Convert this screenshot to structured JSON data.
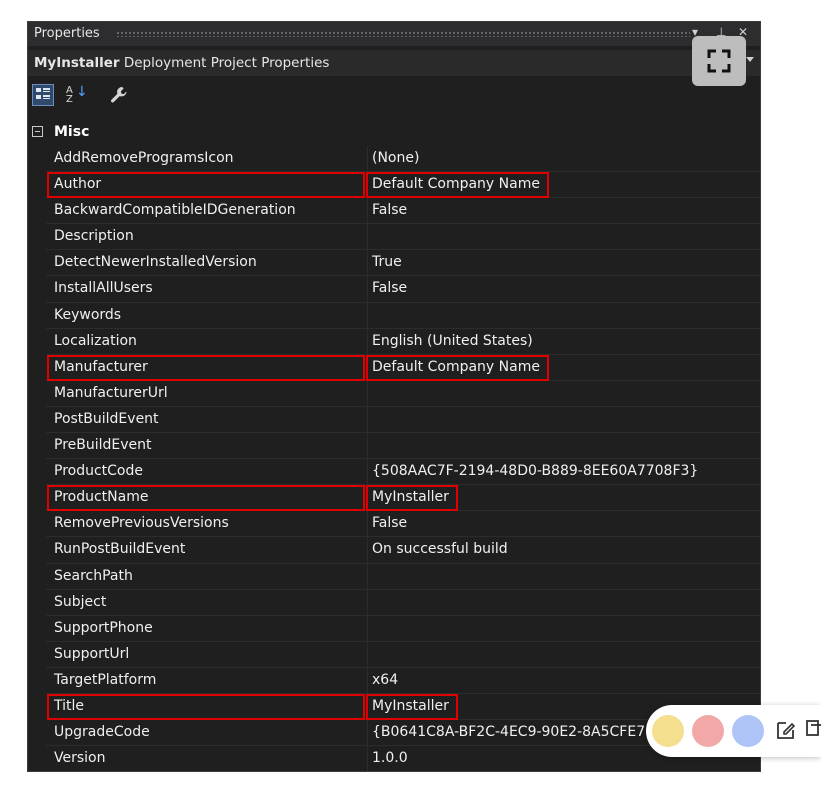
{
  "window": {
    "title": "Properties",
    "controls": [
      "▾",
      "⊥",
      "✕"
    ]
  },
  "object_selector": {
    "name": "MyInstaller",
    "type": "Deployment Project Properties"
  },
  "toolbar": {
    "categorized": "categorized-view-icon",
    "alphabetical": "alphabetical-sort-icon",
    "property_pages": "wrench-icon"
  },
  "category": {
    "name": "Misc"
  },
  "properties": [
    {
      "name": "AddRemoveProgramsIcon",
      "value": "(None)"
    },
    {
      "name": "Author",
      "value": "Default Company Name"
    },
    {
      "name": "BackwardCompatibleIDGeneration",
      "value": "False"
    },
    {
      "name": "Description",
      "value": ""
    },
    {
      "name": "DetectNewerInstalledVersion",
      "value": "True"
    },
    {
      "name": "InstallAllUsers",
      "value": "False"
    },
    {
      "name": "Keywords",
      "value": ""
    },
    {
      "name": "Localization",
      "value": "English (United States)"
    },
    {
      "name": "Manufacturer",
      "value": "Default Company Name"
    },
    {
      "name": "ManufacturerUrl",
      "value": ""
    },
    {
      "name": "PostBuildEvent",
      "value": ""
    },
    {
      "name": "PreBuildEvent",
      "value": ""
    },
    {
      "name": "ProductCode",
      "value": "{508AAC7F-2194-48D0-B889-8EE60A7708F3}"
    },
    {
      "name": "ProductName",
      "value": "MyInstaller"
    },
    {
      "name": "RemovePreviousVersions",
      "value": "False"
    },
    {
      "name": "RunPostBuildEvent",
      "value": "On successful build"
    },
    {
      "name": "SearchPath",
      "value": ""
    },
    {
      "name": "Subject",
      "value": ""
    },
    {
      "name": "SupportPhone",
      "value": ""
    },
    {
      "name": "SupportUrl",
      "value": ""
    },
    {
      "name": "TargetPlatform",
      "value": "x64"
    },
    {
      "name": "Title",
      "value": "MyInstaller"
    },
    {
      "name": "UpgradeCode",
      "value": "{B0641C8A-BF2C-4EC9-90E2-8A5CFE7"
    },
    {
      "name": "Version",
      "value": "1.0.0"
    }
  ],
  "highlighted": [
    "Author",
    "Manufacturer",
    "ProductName",
    "Title"
  ],
  "colors": {
    "panel_bg": "#1f1f1f",
    "highlight": "#e00000",
    "dot_yellow": "#f3df8e",
    "dot_red": "#f3a8a8",
    "dot_blue": "#aec4f7"
  },
  "overlay": {
    "expand_icon": "fullscreen-icon",
    "annotation_icons": [
      "edit-icon",
      "copy-icon"
    ]
  }
}
